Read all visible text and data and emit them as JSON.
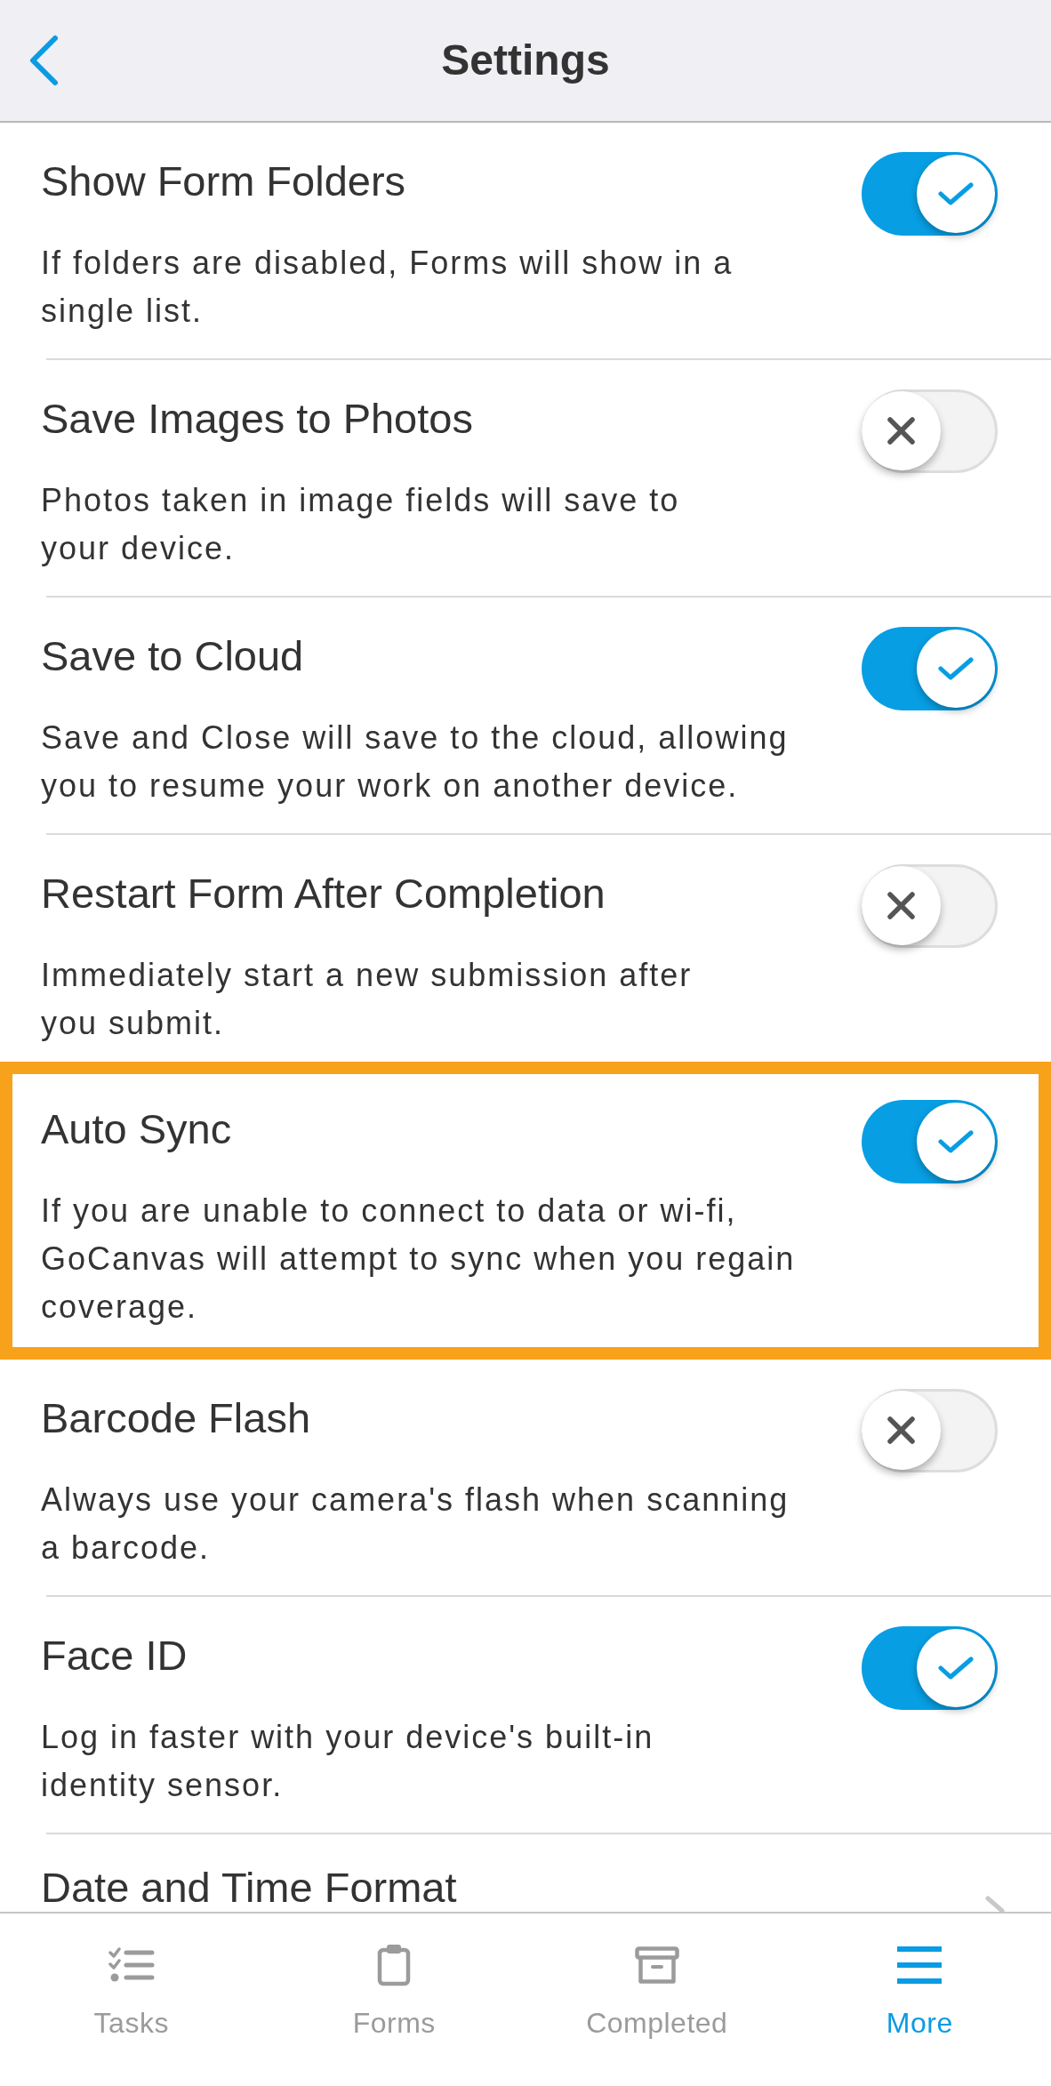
{
  "header": {
    "title": "Settings"
  },
  "settings": [
    {
      "kind": "toggle",
      "title": "Show Form Folders",
      "description": "If folders are disabled, Forms will show in a\nsingle list.",
      "on": true,
      "highlighted": false
    },
    {
      "kind": "toggle",
      "title": "Save Images to Photos",
      "description": "Photos taken in image fields will save to\nyour device.",
      "on": false,
      "highlighted": false
    },
    {
      "kind": "toggle",
      "title": "Save to Cloud",
      "description": "Save and Close will save to the cloud, allowing\nyou to resume your work on another device.",
      "on": true,
      "highlighted": false
    },
    {
      "kind": "toggle",
      "title": "Restart Form After Completion",
      "description": "Immediately start a new submission after\nyou submit.",
      "on": false,
      "highlighted": false
    },
    {
      "kind": "toggle",
      "title": "Auto Sync",
      "description": "If you are unable to connect to data or wi-fi,\nGoCanvas will attempt to sync when you regain\ncoverage.",
      "on": true,
      "highlighted": true
    },
    {
      "kind": "toggle",
      "title": "Barcode Flash",
      "description": "Always use your camera's flash when scanning\na barcode.",
      "on": false,
      "highlighted": false
    },
    {
      "kind": "toggle",
      "title": "Face ID",
      "description": "Log in faster with your device's built-in\nidentity sensor.",
      "on": true,
      "highlighted": false
    },
    {
      "kind": "link",
      "title": "Date and Time Format",
      "highlighted": false
    }
  ],
  "tab_bar": {
    "tabs": [
      {
        "label": "Tasks",
        "selected": false
      },
      {
        "label": "Forms",
        "selected": false
      },
      {
        "label": "Completed",
        "selected": false
      },
      {
        "label": "More",
        "selected": true
      }
    ]
  }
}
